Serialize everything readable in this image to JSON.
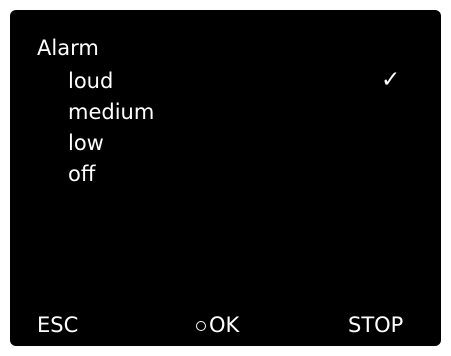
{
  "menu": {
    "title": "Alarm",
    "options": [
      {
        "label": "loud",
        "selected": true
      },
      {
        "label": "medium",
        "selected": false
      },
      {
        "label": "low",
        "selected": false
      },
      {
        "label": "off",
        "selected": false
      }
    ],
    "check_glyph": "✓"
  },
  "softkeys": {
    "esc_label": "ESC",
    "ok_label": "OK",
    "ok_icon": "circle-icon",
    "stop_label": "STOP"
  },
  "colors": {
    "screen_background": "#000000",
    "text": "#ffffff"
  }
}
